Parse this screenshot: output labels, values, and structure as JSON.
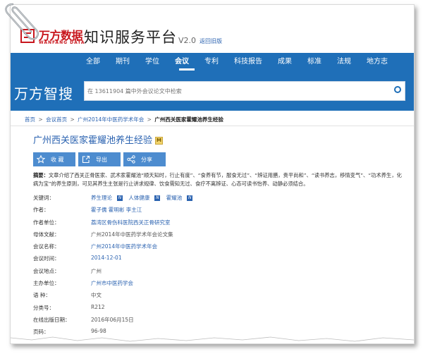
{
  "header": {
    "logo_text": "万方数据",
    "logo_sub": "WANFANG DATA",
    "site_title": "知识服务平台",
    "version": "V2.0",
    "back_link": "返回旧版"
  },
  "nav": {
    "items": [
      {
        "label": "全部"
      },
      {
        "label": "期刊"
      },
      {
        "label": "学位"
      },
      {
        "label": "会议",
        "active": true
      },
      {
        "label": "专利"
      },
      {
        "label": "科技报告"
      },
      {
        "label": "成果"
      },
      {
        "label": "标准"
      },
      {
        "label": "法规"
      },
      {
        "label": "地方志"
      }
    ]
  },
  "search": {
    "brand": "万方智搜",
    "placeholder": "在 13611904 篇中外会议论文中检索"
  },
  "breadcrumb": {
    "home": "首页",
    "sep": ">",
    "conf_home": "会议首页",
    "conference": "广州2014年中医药学术年会",
    "current": "广州西关医家霍耀池养生经验"
  },
  "article": {
    "title": "广州西关医家霍耀池养生经验",
    "badge": "M",
    "actions": {
      "collect": "收 藏",
      "export": "导出",
      "share": "分享"
    },
    "abstract_label": "摘要：",
    "abstract": "文章介绍了西关正骨医家、武术家霍耀池“顺天知时，行止有度”、“食养有节，服食无过”、“辨证用膳，贵平尚和”、“读书养志，移情变气”、“功术养生，化病为宝”的养生原则，可见其养生主张是行止讲求规律、饮食需知无过、食疗不离辨证、心态可读书怡养、动静必须结合。"
  },
  "meta": {
    "keywords_label": "关键词：",
    "keywords": [
      "养生理论",
      "人体健康",
      "霍耀池"
    ],
    "authors_label": "作者：",
    "authors": "霍子儒 霍明彬 李主江",
    "org_label": "作者单位：",
    "org": "荔湾区骨伤科医院西关正骨研究室",
    "parent_doc_label": "母体文献：",
    "parent_doc": "广州2014年中医药学术年会论文集",
    "conf_name_label": "会议名称：",
    "conf_name": "广州2014年中医药学术年会",
    "conf_date_label": "会议时间：",
    "conf_date": "2014-12-01",
    "conf_place_label": "会议地点：",
    "conf_place": "广州",
    "host_label": "主办单位：",
    "host": "广州市中医药学会",
    "lang_label": "语 种：",
    "lang": "中文",
    "class_label": "分类号：",
    "class": "R212",
    "online_label": "在线出版日期：",
    "online": "2016年06月15日",
    "pages_label": "页码：",
    "pages": "96-98"
  },
  "colors": {
    "brand_red": "#c8161d",
    "band_blue": "#1f6fb8",
    "link_blue": "#2a62b0",
    "action_blue": "#4d8ccf"
  }
}
